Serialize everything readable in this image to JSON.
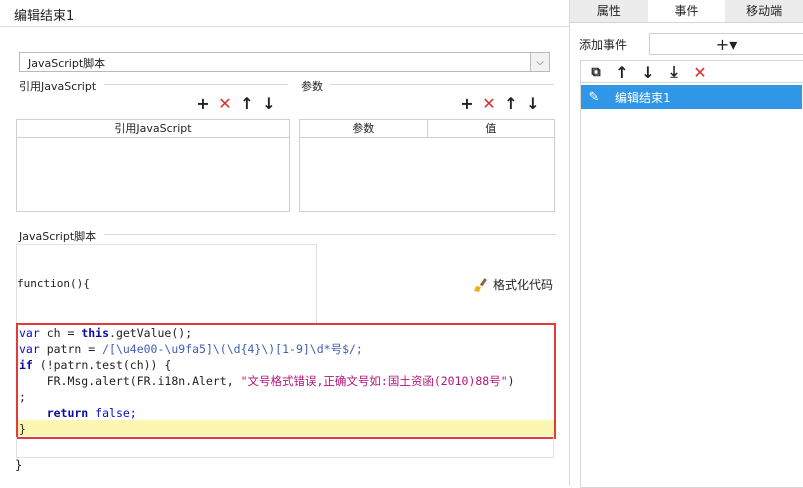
{
  "window": {
    "title": "编辑结束1"
  },
  "script_type": {
    "selected": "JavaScript脚本"
  },
  "ref_js": {
    "label": "引用JavaScript",
    "column": "引用JavaScript"
  },
  "params": {
    "label": "参数",
    "columns": [
      "参数",
      "值"
    ]
  },
  "script": {
    "label": "JavaScript脚本",
    "function_header": "function(){",
    "format_button": "格式化代码",
    "closing": "}"
  },
  "code": {
    "l1_kw": "var",
    "l1_rest_a": " ch = ",
    "l1_this": "this",
    "l1_rest_b": ".getValue();",
    "l2_kw": "var",
    "l2_rest": " patrn = ",
    "l2_regex": "/[\\u4e00-\\u9fa5]\\(\\d{4}\\)[1-9]\\d*号$/;",
    "l3_kw": "if",
    "l3_rest": " (!patrn.test(ch)) {",
    "l4_a": "    FR.Msg.alert(FR.i18n.Alert, ",
    "l4_str": "\"文号格式错误,正确文号如:国土资函(2010)88号\"",
    "l4_b": ")",
    "l5": ";",
    "l6_kw": "    return",
    "l6_rest": " false;",
    "l7": "}"
  },
  "right_panel": {
    "tabs": [
      "属性",
      "事件",
      "移动端"
    ],
    "active_tab": "事件",
    "add_event_label": "添加事件",
    "add_icon": "+▾",
    "events": [
      {
        "label": "编辑结束1"
      }
    ]
  },
  "icons": {
    "add": "plus-icon",
    "delete": "delete-x-icon",
    "up": "arrow-up-icon",
    "down": "arrow-down-icon",
    "brush": "brush-icon",
    "copy": "copy-icon",
    "move_bottom": "move-bottom-icon",
    "edit": "edit-pencil-icon"
  },
  "colors": {
    "selection": "#2f97e6",
    "delete_red": "#d9302c",
    "highlight_border": "#e33a3a",
    "current_line": "#fbf6b2"
  }
}
